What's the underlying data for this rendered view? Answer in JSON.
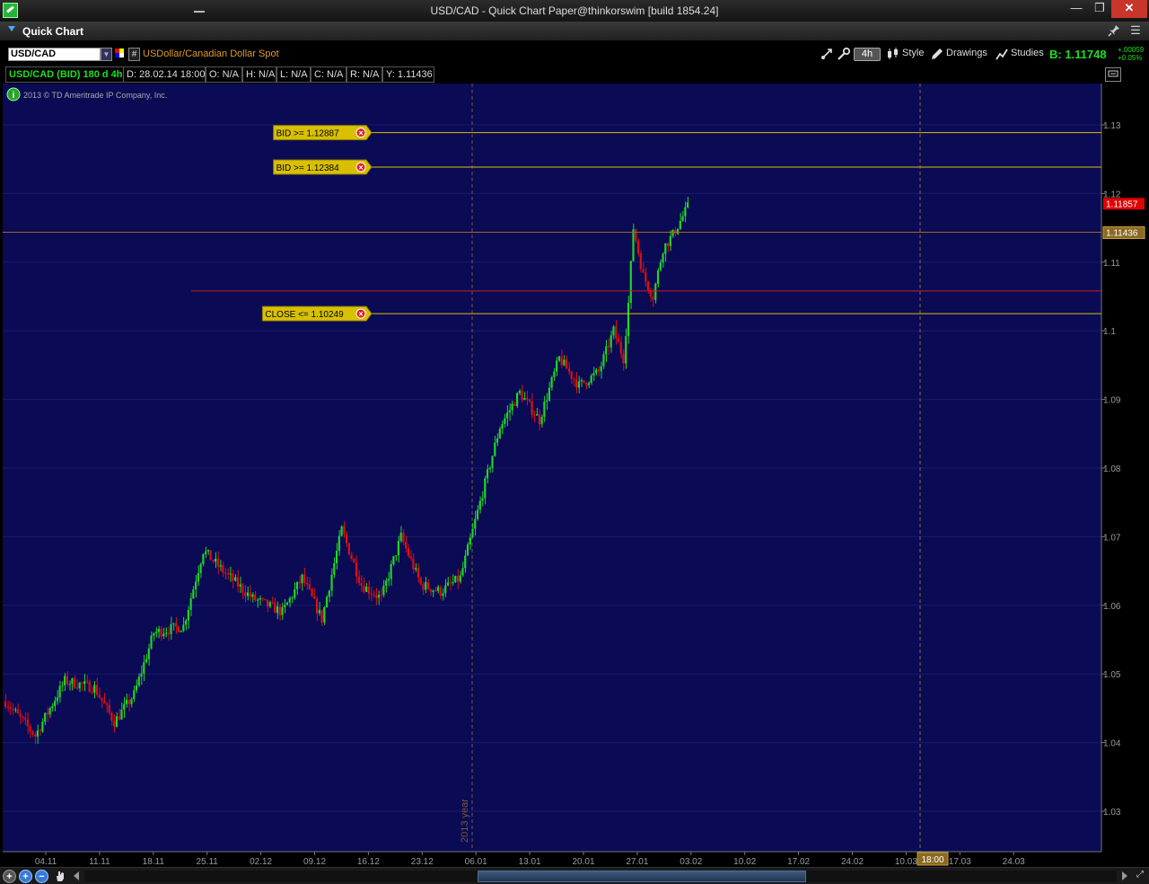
{
  "window": {
    "title": "USD/CAD - Quick Chart Paper@thinkorswim [build 1854.24]",
    "min_glyph": "—",
    "max_glyph": "❐",
    "close_glyph": "✕"
  },
  "panel": {
    "title": "Quick Chart",
    "pin_glyph": "📌",
    "menu_glyph": "☰"
  },
  "toolbar": {
    "symbol": "USD/CAD",
    "description": "USDollar/Canadian Dollar Spot",
    "grid_glyph": "#",
    "timeframe": "4h",
    "style_label": "Style",
    "drawings_label": "Drawings",
    "studies_label": "Studies",
    "bid_price": "B: 1.11748",
    "change_abs": "+.00059",
    "change_pct": "+0.05%",
    "icons": [
      "crosshair-icon",
      "wrench-icon",
      "candles-icon",
      "pencil-icon",
      "studies-icon"
    ]
  },
  "info": {
    "symbol_period": "USD/CAD (BID) 180 d 4h",
    "date": "D: 28.02.14 18:00",
    "open": "O: N/A",
    "high": "H: N/A",
    "low": "L: N/A",
    "close": "C: N/A",
    "range": "R: N/A",
    "y": "Y: 1.11436"
  },
  "chart_data": {
    "type": "candlestick",
    "copyright": "2013 © TD Ameritrade IP Company, Inc.",
    "ylim": [
      1.025,
      1.135
    ],
    "yticks": [
      "1.03",
      "1.04",
      "1.05",
      "1.06",
      "1.07",
      "1.08",
      "1.09",
      "1.1",
      "1.11",
      "1.12",
      "1.13"
    ],
    "xticks": [
      "04.11",
      "11.11",
      "18.11",
      "25.11",
      "02.12",
      "09.12",
      "16.12",
      "23.12",
      "06.01",
      "13.01",
      "20.01",
      "27.01",
      "03.02",
      "10.02",
      "17.02",
      "24.02",
      "10.03",
      "17.03",
      "24.03"
    ],
    "cursor_time_label": "18:00",
    "year_label": "2013 year",
    "alerts": [
      {
        "label": "BID >= 1.12887",
        "value": 1.12887
      },
      {
        "label": "BID >= 1.12384",
        "value": 1.12384
      },
      {
        "label": "CLOSE <= 1.10249",
        "value": 1.10249
      }
    ],
    "red_line_value": 1.1058,
    "last_price": {
      "label": "1.11857",
      "value": 1.11857,
      "color": "#e00000"
    },
    "cursor_price": {
      "label": "1.11436",
      "value": 1.11436
    },
    "up_color": "#22d822",
    "down_color": "#e01010",
    "background_color": "#0a0a55",
    "price_anchors": [
      [
        0,
        1.046
      ],
      [
        6,
        1.041
      ],
      [
        12,
        1.049
      ],
      [
        18,
        1.048
      ],
      [
        22,
        1.043
      ],
      [
        26,
        1.047
      ],
      [
        30,
        1.056
      ],
      [
        36,
        1.057
      ],
      [
        40,
        1.068
      ],
      [
        44,
        1.065
      ],
      [
        50,
        1.061
      ],
      [
        56,
        1.059
      ],
      [
        60,
        1.064
      ],
      [
        64,
        1.058
      ],
      [
        68,
        1.071
      ],
      [
        72,
        1.063
      ],
      [
        76,
        1.061
      ],
      [
        80,
        1.07
      ],
      [
        84,
        1.063
      ],
      [
        88,
        1.062
      ],
      [
        92,
        1.064
      ],
      [
        96,
        1.075
      ],
      [
        100,
        1.086
      ],
      [
        104,
        1.091
      ],
      [
        108,
        1.087
      ],
      [
        112,
        1.096
      ],
      [
        116,
        1.092
      ],
      [
        120,
        1.094
      ],
      [
        123,
        1.1
      ],
      [
        125,
        1.096
      ],
      [
        126,
        1.104
      ],
      [
        127,
        1.115
      ],
      [
        129,
        1.108
      ],
      [
        131,
        1.105
      ],
      [
        133,
        1.112
      ],
      [
        135,
        1.114
      ],
      [
        138,
        1.118
      ]
    ]
  }
}
